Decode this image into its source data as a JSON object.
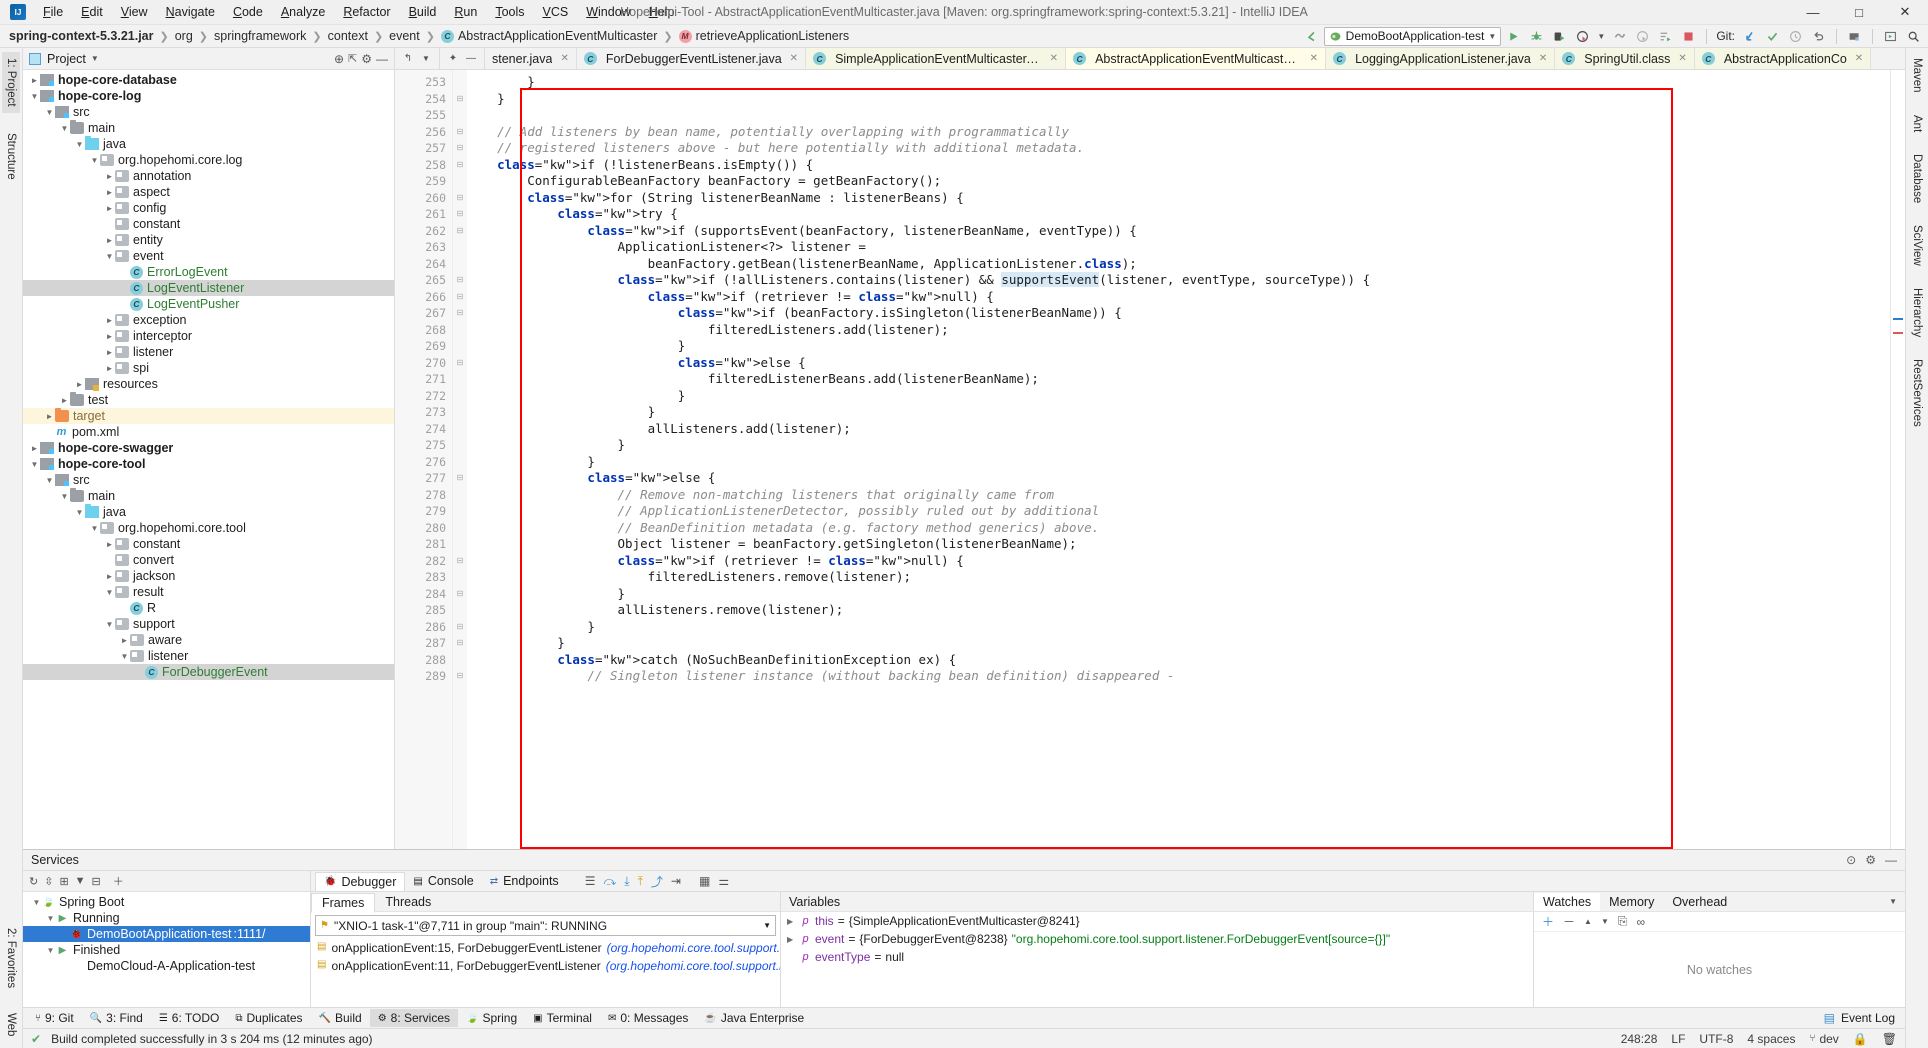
{
  "window": {
    "title": "Hopehomi-Tool - AbstractApplicationEventMulticaster.java [Maven: org.springframework:spring-context:5.3.21] - IntelliJ IDEA",
    "minimize": "—",
    "maximize": "□",
    "close": "✕"
  },
  "menubar": {
    "items": [
      "File",
      "Edit",
      "View",
      "Navigate",
      "Code",
      "Analyze",
      "Refactor",
      "Build",
      "Run",
      "Tools",
      "VCS",
      "Window",
      "Help"
    ]
  },
  "breadcrumb": {
    "items": [
      {
        "label": "spring-context-5.3.21.jar",
        "icon": "",
        "bold": true
      },
      {
        "label": "org",
        "icon": ""
      },
      {
        "label": "springframework",
        "icon": ""
      },
      {
        "label": "context",
        "icon": ""
      },
      {
        "label": "event",
        "icon": ""
      },
      {
        "label": "AbstractApplicationEventMulticaster",
        "icon": "c"
      },
      {
        "label": "retrieveApplicationListeners",
        "icon": "m"
      }
    ]
  },
  "toolbar": {
    "run_config": "DemoBootApplication-test",
    "git_label": "Git:",
    "buttons": [
      "back-arrow-icon",
      "run-icon",
      "debug-icon",
      "run-with-coverage-icon",
      "profiler-icon",
      "attach-icon",
      "stop-icon",
      "update-project-icon",
      "commit-icon",
      "history-icon",
      "rollback-icon",
      "search-everywhere-icon"
    ]
  },
  "project_panel": {
    "title": "Project",
    "tree": [
      {
        "indent": 1,
        "arrow": "►",
        "icon": "mod",
        "label": "hope-core-database",
        "bold": true
      },
      {
        "indent": 1,
        "arrow": "▼",
        "icon": "mod",
        "label": "hope-core-log",
        "bold": true
      },
      {
        "indent": 2,
        "arrow": "▼",
        "icon": "src",
        "label": "src"
      },
      {
        "indent": 3,
        "arrow": "▼",
        "icon": "folder",
        "label": "main"
      },
      {
        "indent": 4,
        "arrow": "▼",
        "icon": "java",
        "label": "java"
      },
      {
        "indent": 5,
        "arrow": "▼",
        "icon": "pkg",
        "label": "org.hopehomi.core.log"
      },
      {
        "indent": 6,
        "arrow": "►",
        "icon": "pkg",
        "label": "annotation"
      },
      {
        "indent": 6,
        "arrow": "►",
        "icon": "pkg",
        "label": "aspect"
      },
      {
        "indent": 6,
        "arrow": "►",
        "icon": "pkg",
        "label": "config"
      },
      {
        "indent": 6,
        "arrow": "",
        "icon": "pkg",
        "label": "constant"
      },
      {
        "indent": 6,
        "arrow": "►",
        "icon": "pkg",
        "label": "entity"
      },
      {
        "indent": 6,
        "arrow": "▼",
        "icon": "pkg",
        "label": "event"
      },
      {
        "indent": 7,
        "arrow": "",
        "icon": "class",
        "label": "ErrorLogEvent",
        "green": true
      },
      {
        "indent": 7,
        "arrow": "",
        "icon": "class",
        "label": "LogEventListener",
        "green": true,
        "selected": true
      },
      {
        "indent": 7,
        "arrow": "",
        "icon": "class",
        "label": "LogEventPusher",
        "green": true
      },
      {
        "indent": 6,
        "arrow": "►",
        "icon": "pkg",
        "label": "exception"
      },
      {
        "indent": 6,
        "arrow": "►",
        "icon": "pkg",
        "label": "interceptor"
      },
      {
        "indent": 6,
        "arrow": "►",
        "icon": "pkg",
        "label": "listener"
      },
      {
        "indent": 6,
        "arrow": "►",
        "icon": "pkg",
        "label": "spi"
      },
      {
        "indent": 4,
        "arrow": "►",
        "icon": "res",
        "label": "resources"
      },
      {
        "indent": 3,
        "arrow": "►",
        "icon": "folder",
        "label": "test"
      },
      {
        "indent": 2,
        "arrow": "►",
        "icon": "target",
        "label": "target",
        "target": true,
        "orange": true
      },
      {
        "indent": 2,
        "arrow": "",
        "icon": "maven",
        "label": "pom.xml"
      },
      {
        "indent": 1,
        "arrow": "►",
        "icon": "mod",
        "label": "hope-core-swagger",
        "bold": true
      },
      {
        "indent": 1,
        "arrow": "▼",
        "icon": "mod",
        "label": "hope-core-tool",
        "bold": true
      },
      {
        "indent": 2,
        "arrow": "▼",
        "icon": "src",
        "label": "src"
      },
      {
        "indent": 3,
        "arrow": "▼",
        "icon": "folder",
        "label": "main"
      },
      {
        "indent": 4,
        "arrow": "▼",
        "icon": "java",
        "label": "java"
      },
      {
        "indent": 5,
        "arrow": "▼",
        "icon": "pkg",
        "label": "org.hopehomi.core.tool"
      },
      {
        "indent": 6,
        "arrow": "►",
        "icon": "pkg",
        "label": "constant"
      },
      {
        "indent": 6,
        "arrow": "",
        "icon": "pkg",
        "label": "convert"
      },
      {
        "indent": 6,
        "arrow": "►",
        "icon": "pkg",
        "label": "jackson"
      },
      {
        "indent": 6,
        "arrow": "▼",
        "icon": "pkg",
        "label": "result"
      },
      {
        "indent": 7,
        "arrow": "",
        "icon": "class",
        "label": "R",
        "green": false
      },
      {
        "indent": 6,
        "arrow": "▼",
        "icon": "pkg",
        "label": "support"
      },
      {
        "indent": 7,
        "arrow": "►",
        "icon": "pkg",
        "label": "aware"
      },
      {
        "indent": 7,
        "arrow": "▼",
        "icon": "pkg",
        "label": "listener"
      },
      {
        "indent": 8,
        "arrow": "",
        "icon": "class",
        "label": "ForDebuggerEvent",
        "green": true,
        "selected": true
      }
    ]
  },
  "editor_tabs": [
    {
      "label": "stener.java",
      "icon": "class",
      "active": false,
      "truncated": true
    },
    {
      "label": "ForDebuggerEventListener.java",
      "icon": "class",
      "active": false
    },
    {
      "label": "SimpleApplicationEventMulticaster.java",
      "icon": "class",
      "active": false,
      "tint": true
    },
    {
      "label": "AbstractApplicationEventMulticaster.java",
      "icon": "class",
      "active": true
    },
    {
      "label": "LoggingApplicationListener.java",
      "icon": "class",
      "active": false,
      "tint": true
    },
    {
      "label": "SpringUtil.class",
      "icon": "class",
      "active": false,
      "tint": true
    },
    {
      "label": "AbstractApplicationCo",
      "icon": "class",
      "active": false,
      "tint": true,
      "truncated": true
    }
  ],
  "editor": {
    "first_line": 253,
    "lines": [
      {
        "n": 253,
        "text": "        }",
        "fold": ""
      },
      {
        "n": 254,
        "text": "    }",
        "fold": "⊟"
      },
      {
        "n": 255,
        "text": "",
        "fold": ""
      },
      {
        "n": 256,
        "text": "    // Add listeners by bean name, potentially overlapping with programmatically",
        "fold": "⊟",
        "comment": true
      },
      {
        "n": 257,
        "text": "    // registered listeners above - but here potentially with additional metadata.",
        "fold": "⊟",
        "comment": true
      },
      {
        "n": 258,
        "text": "    if (!listenerBeans.isEmpty()) {",
        "fold": "⊟"
      },
      {
        "n": 259,
        "text": "        ConfigurableBeanFactory beanFactory = getBeanFactory();",
        "fold": ""
      },
      {
        "n": 260,
        "text": "        for (String listenerBeanName : listenerBeans) {",
        "fold": "⊟"
      },
      {
        "n": 261,
        "text": "            try {",
        "fold": "⊟"
      },
      {
        "n": 262,
        "text": "                if (supportsEvent(beanFactory, listenerBeanName, eventType)) {",
        "fold": "⊟"
      },
      {
        "n": 263,
        "text": "                    ApplicationListener<?> listener =",
        "fold": ""
      },
      {
        "n": 264,
        "text": "                        beanFactory.getBean(listenerBeanName, ApplicationListener.class);",
        "fold": ""
      },
      {
        "n": 265,
        "text": "                    if (!allListeners.contains(listener) && supportsEvent(listener, eventType, sourceType)) {",
        "fold": "⊟"
      },
      {
        "n": 266,
        "text": "                        if (retriever != null) {",
        "fold": "⊟"
      },
      {
        "n": 267,
        "text": "                            if (beanFactory.isSingleton(listenerBeanName)) {",
        "fold": "⊟"
      },
      {
        "n": 268,
        "text": "                                filteredListeners.add(listener);",
        "fold": ""
      },
      {
        "n": 269,
        "text": "                            }",
        "fold": ""
      },
      {
        "n": 270,
        "text": "                            else {",
        "fold": "⊟"
      },
      {
        "n": 271,
        "text": "                                filteredListenerBeans.add(listenerBeanName);",
        "fold": ""
      },
      {
        "n": 272,
        "text": "                            }",
        "fold": ""
      },
      {
        "n": 273,
        "text": "                        }",
        "fold": ""
      },
      {
        "n": 274,
        "text": "                        allListeners.add(listener);",
        "fold": ""
      },
      {
        "n": 275,
        "text": "                    }",
        "fold": ""
      },
      {
        "n": 276,
        "text": "                }",
        "fold": ""
      },
      {
        "n": 277,
        "text": "                else {",
        "fold": "⊟"
      },
      {
        "n": 278,
        "text": "                    // Remove non-matching listeners that originally came from",
        "fold": "",
        "comment": true
      },
      {
        "n": 279,
        "text": "                    // ApplicationListenerDetector, possibly ruled out by additional",
        "fold": "",
        "comment": true
      },
      {
        "n": 280,
        "text": "                    // BeanDefinition metadata (e.g. factory method generics) above.",
        "fold": "",
        "comment": true
      },
      {
        "n": 281,
        "text": "                    Object listener = beanFactory.getSingleton(listenerBeanName);",
        "fold": ""
      },
      {
        "n": 282,
        "text": "                    if (retriever != null) {",
        "fold": "⊟"
      },
      {
        "n": 283,
        "text": "                        filteredListeners.remove(listener);",
        "fold": ""
      },
      {
        "n": 284,
        "text": "                    }",
        "fold": "⊟"
      },
      {
        "n": 285,
        "text": "                    allListeners.remove(listener);",
        "fold": ""
      },
      {
        "n": 286,
        "text": "                }",
        "fold": "⊟"
      },
      {
        "n": 287,
        "text": "            }",
        "fold": "⊟"
      },
      {
        "n": 288,
        "text": "            catch (NoSuchBeanDefinitionException ex) {",
        "fold": ""
      },
      {
        "n": 289,
        "text": "                // Singleton listener instance (without backing bean definition) disappeared -",
        "fold": "⊟",
        "comment": true
      }
    ]
  },
  "services": {
    "title": "Services",
    "tree": [
      {
        "indent": 1,
        "arrow": "▼",
        "icon": "spring",
        "label": "Spring Boot"
      },
      {
        "indent": 2,
        "arrow": "▼",
        "icon": "run-green",
        "label": "Running"
      },
      {
        "indent": 3,
        "arrow": "",
        "icon": "bug",
        "label": "DemoBootApplication-test",
        "suffix": ":1111/",
        "selected": true
      },
      {
        "indent": 2,
        "arrow": "▼",
        "icon": "run-green",
        "label": "Finished"
      },
      {
        "indent": 3,
        "arrow": "",
        "icon": "",
        "label": "DemoCloud-A-Application-test"
      }
    ],
    "debug_tabs": [
      {
        "label": "Debugger",
        "icon": "debug-icon",
        "active": true
      },
      {
        "label": "Console",
        "icon": "console-icon",
        "active": false
      },
      {
        "label": "Endpoints",
        "icon": "endpoints-icon",
        "active": false
      }
    ],
    "frames": {
      "tabs": [
        {
          "label": "Frames",
          "active": true
        },
        {
          "label": "Threads",
          "active": false
        }
      ],
      "thread": "\"XNIO-1 task-1\"@7,711 in group \"main\": RUNNING",
      "items": [
        {
          "name": "onApplicationEvent:15, ForDebuggerEventListener",
          "loc": "(org.hopehomi.core.tool.support.listener)"
        },
        {
          "name": "onApplicationEvent:11, ForDebuggerEventListener",
          "loc": "(org.hopehomi.core.tool.support.listener)"
        }
      ]
    },
    "variables": {
      "header": "Variables",
      "rows": [
        {
          "arrow": "▶",
          "kind": "p",
          "name": "this",
          "eq": " = ",
          "value": "{SimpleApplicationEventMulticaster@8241}"
        },
        {
          "arrow": "▶",
          "kind": "p",
          "name": "event",
          "eq": " = ",
          "value": "{ForDebuggerEvent@8238} ",
          "str": "\"org.hopehomi.core.tool.support.listener.ForDebuggerEvent[source={}]\""
        },
        {
          "arrow": "",
          "kind": "p",
          "name": "eventType",
          "eq": " = ",
          "value": "null"
        }
      ]
    },
    "watches": {
      "tabs": [
        {
          "label": "Watches",
          "active": true
        },
        {
          "label": "Memory",
          "active": false
        },
        {
          "label": "Overhead",
          "active": false
        }
      ],
      "empty_text": "No watches"
    }
  },
  "toolwindow_bar": {
    "items": [
      {
        "label": "9: Git",
        "icon": "git-icon",
        "active": false
      },
      {
        "label": "3: Find",
        "icon": "find-icon",
        "active": false
      },
      {
        "label": "6: TODO",
        "icon": "todo-icon",
        "active": false
      },
      {
        "label": "Duplicates",
        "icon": "duplicates-icon",
        "active": false
      },
      {
        "label": "Build",
        "icon": "build-icon",
        "active": false
      },
      {
        "label": "8: Services",
        "icon": "services-icon",
        "active": true
      },
      {
        "label": "Spring",
        "icon": "spring-icon",
        "active": false
      },
      {
        "label": "Terminal",
        "icon": "terminal-icon",
        "active": false
      },
      {
        "label": "0: Messages",
        "icon": "messages-icon",
        "active": false
      },
      {
        "label": "Java Enterprise",
        "icon": "java-ee-icon",
        "active": false
      }
    ],
    "right": "Event Log"
  },
  "statusbar": {
    "message": "Build completed successfully in 3 s 204 ms (12 minutes ago)",
    "position": "248:28",
    "line_sep": "LF",
    "encoding": "UTF-8",
    "indent": "4 spaces",
    "branch": "dev"
  },
  "left_rail": [
    {
      "label": "1: Project",
      "active": true
    },
    {
      "label": "Structure",
      "active": false
    },
    {
      "label": "2: Favorites",
      "active": false
    },
    {
      "label": "Web",
      "active": false
    }
  ],
  "right_rail": [
    {
      "label": "Maven",
      "active": false
    },
    {
      "label": "Ant",
      "active": false
    },
    {
      "label": "Database",
      "active": false
    },
    {
      "label": "SciView",
      "active": false
    },
    {
      "label": "Hierarchy",
      "active": false
    },
    {
      "label": "RestServices",
      "active": false
    }
  ],
  "colors": {
    "accent": "#2f7bd4",
    "highlight_box": "#ff0000",
    "keyword": "#0033b3",
    "comment": "#8c8c8c",
    "string": "#067d17",
    "green": "#59a869"
  }
}
